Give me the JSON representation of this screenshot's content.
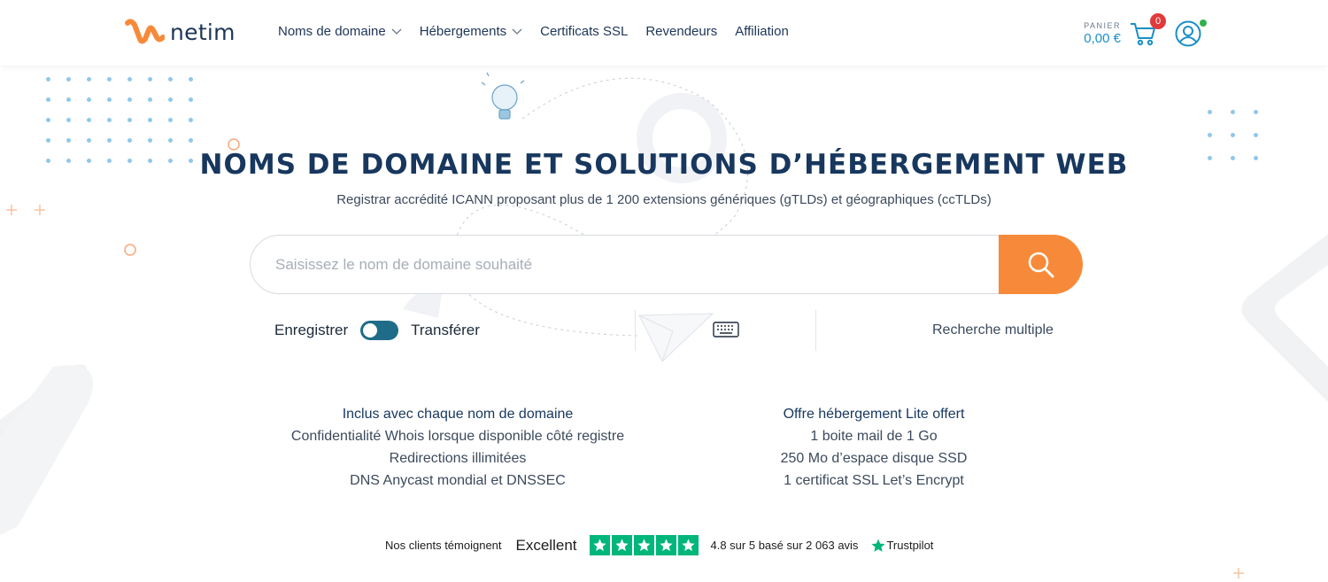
{
  "header": {
    "logo_text": "netim",
    "nav": [
      {
        "label": "Noms de domaine",
        "has_dropdown": true
      },
      {
        "label": "Hébergements",
        "has_dropdown": true
      },
      {
        "label": "Certificats SSL",
        "has_dropdown": false
      },
      {
        "label": "Revendeurs",
        "has_dropdown": false
      },
      {
        "label": "Affiliation",
        "has_dropdown": false
      }
    ],
    "cart": {
      "label": "PANIER",
      "amount": "0,00 €",
      "count": "0"
    },
    "icons": {
      "cart": "cart-icon",
      "user": "user-icon"
    }
  },
  "hero": {
    "title": "NOMS DE DOMAINE ET SOLUTIONS D’HÉBERGEMENT WEB",
    "subtitle": "Registrar accrédité ICANN proposant plus de 1 200 extensions génériques (gTLDs) et géographiques (ccTLDs)"
  },
  "search": {
    "placeholder": "Saisissez le nom de domaine souhaité",
    "value": "",
    "button_icon": "search-icon"
  },
  "mode": {
    "left_label": "Enregistrer",
    "right_label": "Transférer",
    "keyboard_icon": "keyboard-icon",
    "multi_label": "Recherche multiple"
  },
  "included": {
    "title": "Inclus avec chaque nom de domaine",
    "items": [
      "Confidentialité Whois lorsque disponible côté registre",
      "Redirections illimitées",
      "DNS Anycast mondial et DNSSEC"
    ]
  },
  "offer": {
    "title": "Offre hébergement Lite offert",
    "items": [
      "1 boite mail de 1 Go",
      "250 Mo d’espace disque SSD",
      "1 certificat SSL Let’s Encrypt"
    ]
  },
  "trust": {
    "intro": "Nos clients témoignent",
    "verdict": "Excellent",
    "stars": 5,
    "rating": "4.8 sur 5 basé sur 2 063 avis",
    "brand": "Trustpilot"
  },
  "colors": {
    "accent": "#f78a3a",
    "navy": "#17375e",
    "link": "#1a8fc7",
    "toggle": "#1f6c88",
    "trustpilot_green": "#00b67a",
    "badge_red": "#e03a3a"
  }
}
